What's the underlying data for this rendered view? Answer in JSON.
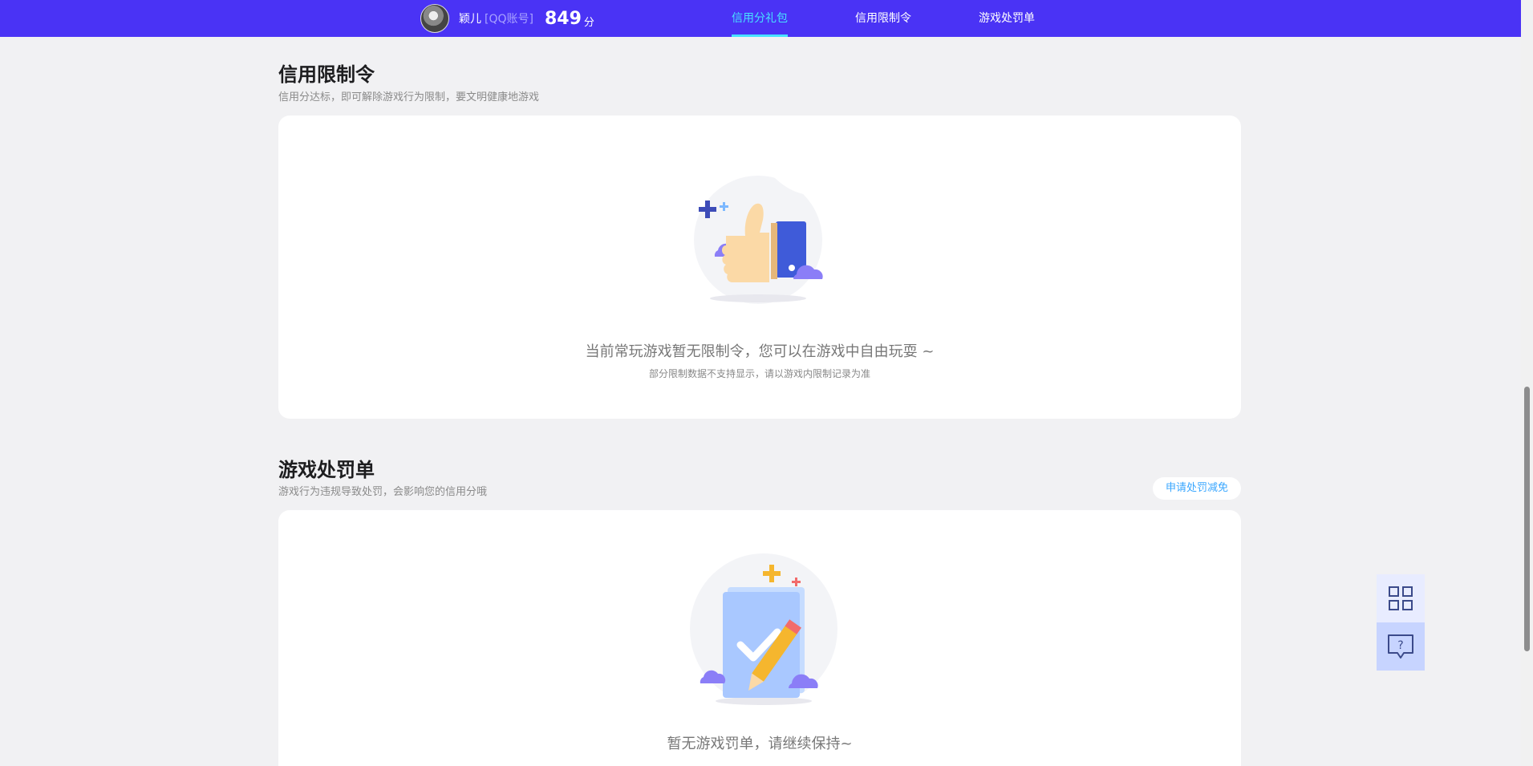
{
  "header": {
    "username": "颖儿",
    "account_type": "[QQ账号]",
    "score": "849",
    "score_unit": "分",
    "nav": [
      {
        "label": "信用分礼包",
        "active": true
      },
      {
        "label": "信用限制令",
        "active": false
      },
      {
        "label": "游戏处罚单",
        "active": false
      }
    ]
  },
  "restriction": {
    "title": "信用限制令",
    "subtitle": "信用分达标，即可解除游戏行为限制，要文明健康地游戏",
    "empty_main": "当前常玩游戏暂无限制令，您可以在游戏中自由玩耍 ~",
    "empty_sub": "部分限制数据不支持显示，请以游戏内限制记录为准"
  },
  "penalty": {
    "title": "游戏处罚单",
    "subtitle": "游戏行为违规导致处罚，会影响您的信用分哦",
    "apply_button": "申请处罚减免",
    "empty_main": "暂无游戏罚单，请继续保持~"
  },
  "floating_tools": [
    {
      "icon": "qr-code-icon"
    },
    {
      "icon": "help-chat-icon"
    }
  ],
  "colors": {
    "topbar": "#4a33f5",
    "active_nav": "#47e2ff",
    "page_bg": "#f1f1f3",
    "card_bg": "#ffffff"
  }
}
